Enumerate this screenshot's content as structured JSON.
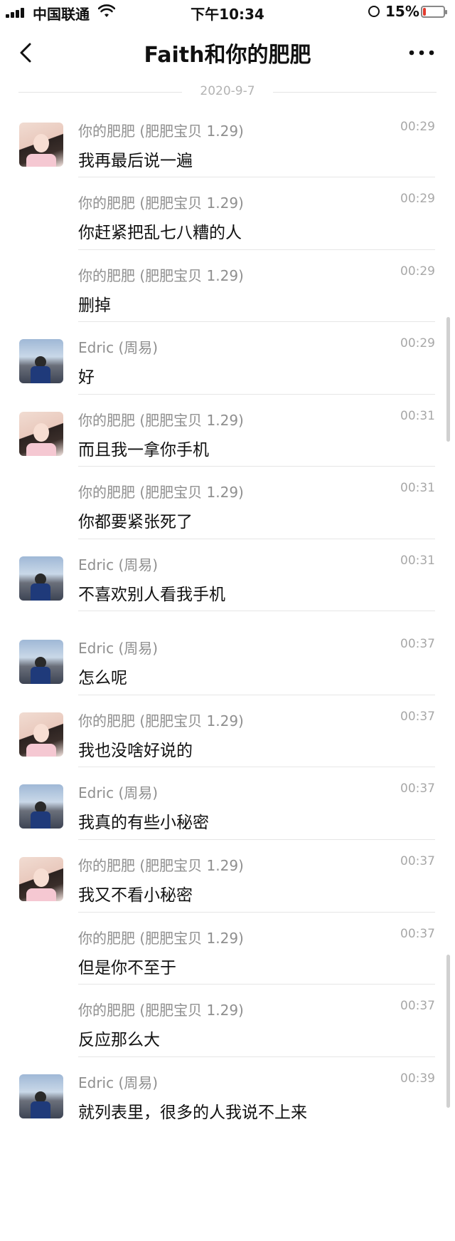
{
  "status_bar": {
    "carrier": "中国联通",
    "time": "下午10:34",
    "battery_percent": "15%",
    "battery_level": 0.15,
    "battery_color": "#e23b2e"
  },
  "nav": {
    "title": "Faith和你的肥肥",
    "back_icon": "chevron-left-icon",
    "more_icon": "more-dots-icon"
  },
  "date_divider": "2020-9-7",
  "messages": [
    {
      "sender": "你的肥肥 (肥肥宝贝 1.29)",
      "time": "00:29",
      "text": "我再最后说一遍",
      "avatar": "faith"
    },
    {
      "sender": "你的肥肥 (肥肥宝贝 1.29)",
      "time": "00:29",
      "text": "你赶紧把乱七八糟的人",
      "avatar": ""
    },
    {
      "sender": "你的肥肥 (肥肥宝贝 1.29)",
      "time": "00:29",
      "text": "删掉",
      "avatar": ""
    },
    {
      "sender": "Edric (周易)",
      "time": "00:29",
      "text": "好",
      "avatar": "edric"
    },
    {
      "sender": "你的肥肥 (肥肥宝贝 1.29)",
      "time": "00:31",
      "text": "而且我一拿你手机",
      "avatar": "faith"
    },
    {
      "sender": "你的肥肥 (肥肥宝贝 1.29)",
      "time": "00:31",
      "text": "你都要紧张死了",
      "avatar": ""
    },
    {
      "sender": "Edric (周易)",
      "time": "00:31",
      "text": "不喜欢别人看我手机",
      "avatar": "edric"
    },
    {
      "sender": "Edric (周易)",
      "time": "00:37",
      "text": "怎么呢",
      "avatar": "edric"
    },
    {
      "sender": "你的肥肥 (肥肥宝贝 1.29)",
      "time": "00:37",
      "text": "我也没啥好说的",
      "avatar": "faith"
    },
    {
      "sender": "Edric (周易)",
      "time": "00:37",
      "text": "我真的有些小秘密",
      "avatar": "edric"
    },
    {
      "sender": "你的肥肥 (肥肥宝贝 1.29)",
      "time": "00:37",
      "text": "我又不看小秘密",
      "avatar": "faith"
    },
    {
      "sender": "你的肥肥 (肥肥宝贝 1.29)",
      "time": "00:37",
      "text": "但是你不至于",
      "avatar": ""
    },
    {
      "sender": "你的肥肥 (肥肥宝贝 1.29)",
      "time": "00:37",
      "text": "反应那么大",
      "avatar": ""
    },
    {
      "sender": "Edric (周易)",
      "time": "00:39",
      "text": "就列表里，很多的人我说不上来",
      "avatar": "edric"
    }
  ]
}
